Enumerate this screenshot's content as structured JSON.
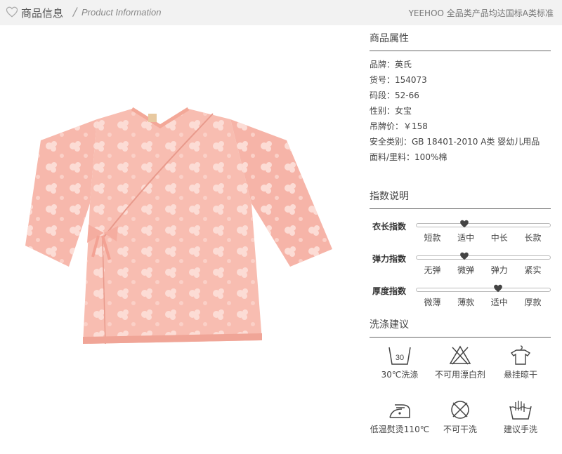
{
  "header": {
    "title": "商品信息",
    "slash": "/",
    "subtitle": "Product Information",
    "right_text": "YEEHOO 全品类产品均达国标A类标准"
  },
  "attributes": {
    "title": "商品属性",
    "items": [
      "品牌：英氏",
      "货号：154073",
      "码段：52-66",
      "性别：女宝",
      "吊牌价：￥158",
      "安全类别：GB 18401-2010  A类 婴幼儿用品",
      "面料/里料：100%棉"
    ]
  },
  "indices": {
    "title": "指数说明",
    "rows": [
      {
        "label": "衣长指数",
        "ticks": [
          "短款",
          "适中",
          "中长",
          "长款"
        ],
        "level": 0.36
      },
      {
        "label": "弹力指数",
        "ticks": [
          "无弹",
          "微弹",
          "弹力",
          "紧实"
        ],
        "level": 0.36
      },
      {
        "label": "厚度指数",
        "ticks": [
          "微薄",
          "薄款",
          "适中",
          "厚款"
        ],
        "level": 0.61
      }
    ]
  },
  "wash": {
    "title": "洗涤建议",
    "items": [
      {
        "icon": "wash-30-icon",
        "label": "30℃洗涤",
        "temp": "30"
      },
      {
        "icon": "no-bleach-icon",
        "label": "不可用漂白剂"
      },
      {
        "icon": "hang-dry-icon",
        "label": "悬挂晾干"
      },
      {
        "icon": "low-iron-icon",
        "label": "低温熨烫110℃"
      },
      {
        "icon": "no-tumble-dry-icon",
        "label": "不可干洗"
      },
      {
        "icon": "hand-wash-icon",
        "label": "建议手洗"
      }
    ]
  },
  "colors": {
    "accent": "#555555",
    "garment": "#f7b8ac",
    "pattern": "#fbd6cf"
  }
}
